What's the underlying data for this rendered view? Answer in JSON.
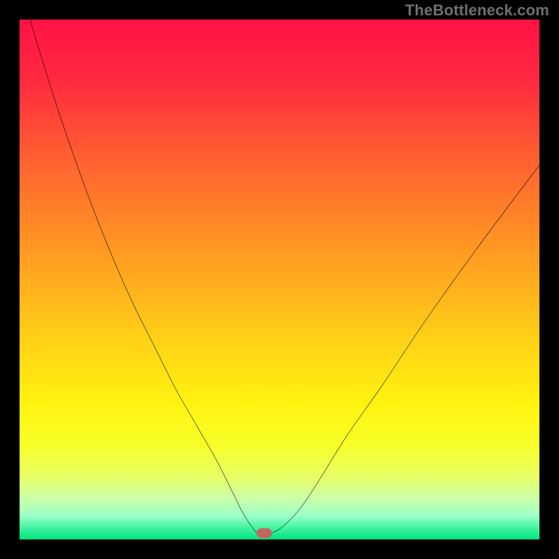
{
  "attribution": "TheBottleneck.com",
  "chart_data": {
    "type": "line",
    "title": "",
    "xlabel": "",
    "ylabel": "",
    "xlim": [
      0,
      100
    ],
    "ylim": [
      0,
      100
    ],
    "grid": false,
    "legend": false,
    "series": [
      {
        "name": "bottleneck-curve",
        "x": [
          2,
          6,
          10,
          14,
          18,
          22,
          26,
          30,
          34,
          38,
          41,
          43,
          45,
          46,
          47,
          50,
          54,
          58,
          63,
          70,
          78,
          88,
          100
        ],
        "y": [
          100,
          87,
          75,
          64,
          54,
          45,
          37,
          29,
          22,
          15,
          9,
          5,
          2,
          1,
          1,
          2,
          6,
          12,
          20,
          30,
          42,
          56,
          72
        ]
      }
    ],
    "marker": {
      "x": 47,
      "y": 1.2,
      "color": "#c1675f"
    },
    "gradient_stops": [
      {
        "pos": 0.0,
        "color": "#ff1345"
      },
      {
        "pos": 0.12,
        "color": "#ff2a3f"
      },
      {
        "pos": 0.25,
        "color": "#ff5a32"
      },
      {
        "pos": 0.38,
        "color": "#ff8427"
      },
      {
        "pos": 0.5,
        "color": "#ffab1e"
      },
      {
        "pos": 0.62,
        "color": "#ffd216"
      },
      {
        "pos": 0.74,
        "color": "#fff30f"
      },
      {
        "pos": 0.82,
        "color": "#f7ff2a"
      },
      {
        "pos": 0.88,
        "color": "#e8ff66"
      },
      {
        "pos": 0.92,
        "color": "#ccffa8"
      },
      {
        "pos": 0.955,
        "color": "#9cffc8"
      },
      {
        "pos": 0.975,
        "color": "#4cf5a5"
      },
      {
        "pos": 1.0,
        "color": "#00e57e"
      }
    ]
  }
}
